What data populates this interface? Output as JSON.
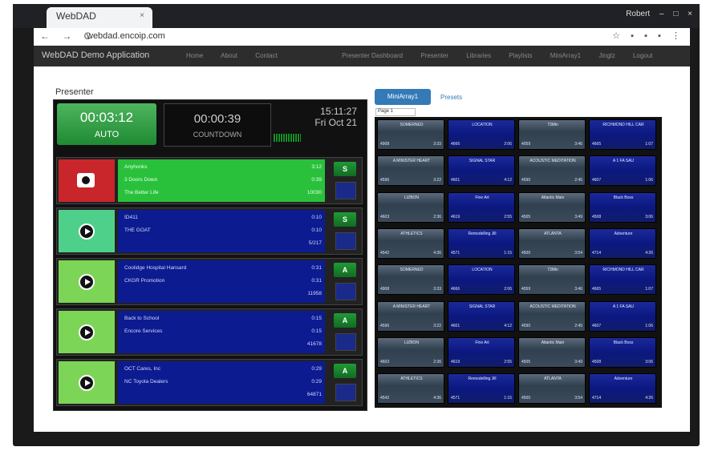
{
  "browser": {
    "tab_title": "WebDAD",
    "tab_close": "×",
    "url": "webdad.encoip.com",
    "window_user": "Robert",
    "nav_glyphs": "← → C",
    "ext_glyphs": [
      "☆",
      "▪",
      "▪",
      "▪",
      "⋮"
    ],
    "win_controls": [
      "–",
      "□",
      "×"
    ]
  },
  "navbar": {
    "brand": "WebDAD Demo Application",
    "links": [
      "Home",
      "About",
      "Contact",
      "Presenter Dashboard",
      "Presenter",
      "Libraries",
      "Playlists",
      "MiniArray1",
      "Jinglz",
      "Logout"
    ]
  },
  "presenter": {
    "title": "Presenter",
    "clock": {
      "time": "00:03:12",
      "mode": "AUTO"
    },
    "countdown": {
      "time": "00:00:39",
      "label": "COUNTDOWN"
    },
    "datetime": {
      "time": "15:11:27",
      "date": "Fri Oct 21"
    },
    "carts": [
      {
        "state": "stop",
        "color": "#c8262a",
        "line1": "Anyhonks",
        "line2": "3 Doors Down",
        "line3": "The Better Life",
        "d1": "3:12",
        "d2": "0:39",
        "d3": "10030",
        "btn": "S",
        "bg": "#29c13c",
        "text_color": "#e9ffe9"
      },
      {
        "state": "play",
        "color": "#4fd08a",
        "line1": "ID411",
        "line2": "THE GOAT",
        "line3": "",
        "d1": "0:10",
        "d2": "0:10",
        "d3": "5/217",
        "btn": "S",
        "bg": "#0d1b90",
        "text_color": "#cfd8ff"
      },
      {
        "state": "play",
        "color": "#7cd557",
        "line1": "Coolidge Hospital Hansard",
        "line2": "CKGR Promotion",
        "line3": "",
        "d1": "0:31",
        "d2": "0:31",
        "d3": "11958",
        "btn": "A",
        "bg": "#0d1b90",
        "text_color": "#cfd8ff"
      },
      {
        "state": "play",
        "color": "#7cd557",
        "line1": "Back to School",
        "line2": "Encore Services",
        "line3": "",
        "d1": "0:15",
        "d2": "0:15",
        "d3": "41678",
        "btn": "A",
        "bg": "#0d1b90",
        "text_color": "#cfd8ff"
      },
      {
        "state": "play",
        "color": "#7cd557",
        "line1": "OCT Cares, Inc",
        "line2": "NC Toyota Dealers",
        "line3": "",
        "d1": "0:29",
        "d2": "0:29",
        "d3": "64871",
        "btn": "A",
        "bg": "#0d1b90",
        "text_color": "#cfd8ff"
      }
    ]
  },
  "array": {
    "tabs": [
      "MiniArray1",
      "Presets"
    ],
    "page_select": "Page  1",
    "cells": [
      {
        "style": "gray",
        "name": "SOMERNED",
        "code": "4908",
        "dur": "3:33"
      },
      {
        "style": "blue",
        "name": "LOCATION",
        "code": "4666",
        "dur": "2:06"
      },
      {
        "style": "gray",
        "name": "73Min",
        "code": "4059",
        "dur": "3:46"
      },
      {
        "style": "blue",
        "name": "RICHMOND HILL CAR",
        "code": "4665",
        "dur": "1:07"
      },
      {
        "style": "gray",
        "name": "A MINISTER HEART",
        "code": "4596",
        "dur": "3:22"
      },
      {
        "style": "blue",
        "name": "SIGNAL STAR",
        "code": "4601",
        "dur": "4:12"
      },
      {
        "style": "gray",
        "name": "ACOUSTIC MEDITATION",
        "code": "4590",
        "dur": "2:45"
      },
      {
        "style": "blue",
        "name": "A 1 FA SAU",
        "code": "4607",
        "dur": "1:06"
      },
      {
        "style": "gray",
        "name": "LIZBON",
        "code": "4603",
        "dur": "2:36"
      },
      {
        "style": "blue",
        "name": "Fine Art",
        "code": "4619",
        "dur": "2:55"
      },
      {
        "style": "gray",
        "name": "Atlantic Main",
        "code": "4505",
        "dur": "3:49"
      },
      {
        "style": "blue",
        "name": "Black Boss",
        "code": "4508",
        "dur": "3:06"
      },
      {
        "style": "gray",
        "name": "ATHLETICS",
        "code": "4542",
        "dur": "4:36"
      },
      {
        "style": "blue",
        "name": "Remodelling Jill",
        "code": "4571",
        "dur": "1:15"
      },
      {
        "style": "gray",
        "name": "ATLANTA",
        "code": "4500",
        "dur": "3:54"
      },
      {
        "style": "blue",
        "name": "Adventure",
        "code": "4714",
        "dur": "4:26"
      },
      {
        "style": "gray",
        "name": "SOMERNED",
        "code": "4908",
        "dur": "3:33"
      },
      {
        "style": "blue",
        "name": "LOCATION",
        "code": "4666",
        "dur": "2:06"
      },
      {
        "style": "gray",
        "name": "73Min",
        "code": "4059",
        "dur": "3:46"
      },
      {
        "style": "blue",
        "name": "RICHMOND HILL CAR",
        "code": "4665",
        "dur": "1:07"
      },
      {
        "style": "gray",
        "name": "A MINISTER HEART",
        "code": "4596",
        "dur": "3:22"
      },
      {
        "style": "blue",
        "name": "SIGNAL STAR",
        "code": "4601",
        "dur": "4:12"
      },
      {
        "style": "gray",
        "name": "ACOUSTIC MEDITATION",
        "code": "4590",
        "dur": "2:45"
      },
      {
        "style": "blue",
        "name": "A 1 FA SAU",
        "code": "4607",
        "dur": "1:06"
      },
      {
        "style": "gray",
        "name": "LIZBON",
        "code": "4603",
        "dur": "2:36"
      },
      {
        "style": "blue",
        "name": "Fine Art",
        "code": "4619",
        "dur": "2:55"
      },
      {
        "style": "gray",
        "name": "Atlantic Main",
        "code": "4505",
        "dur": "3:49"
      },
      {
        "style": "blue",
        "name": "Black Boss",
        "code": "4508",
        "dur": "3:06"
      },
      {
        "style": "gray",
        "name": "ATHLETICS",
        "code": "4542",
        "dur": "4:36"
      },
      {
        "style": "blue",
        "name": "Remodelling Jill",
        "code": "4571",
        "dur": "1:15"
      },
      {
        "style": "gray",
        "name": "ATLANTA",
        "code": "4500",
        "dur": "3:54"
      },
      {
        "style": "blue",
        "name": "Adventure",
        "code": "4714",
        "dur": "4:26"
      }
    ]
  }
}
